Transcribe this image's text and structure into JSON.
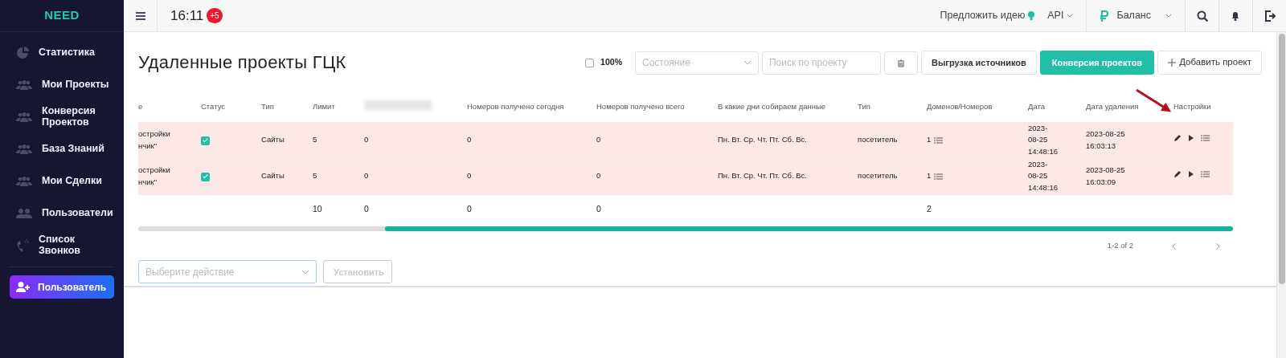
{
  "sidebar": {
    "logo": "NEED",
    "items": [
      {
        "label": "Статистика",
        "kind": "pie"
      },
      {
        "label": "Мои Проекты",
        "kind": "users"
      },
      {
        "label": "Конверсия Проектов",
        "kind": "users"
      },
      {
        "label": "База Знаний",
        "kind": "users"
      },
      {
        "label": "Мои Сделки",
        "kind": "users"
      },
      {
        "label": "Пользователи",
        "kind": "pair"
      },
      {
        "label": "Список Звонков",
        "kind": "phone"
      }
    ],
    "user_button": "Пользователь"
  },
  "topbar": {
    "time": "16:11",
    "badge": "+5",
    "idea_link": "Предложить идею",
    "api_link": "API",
    "balance": "Баланс"
  },
  "page": {
    "title": "Удаленные проекты ГЦК"
  },
  "toolbar": {
    "checkbox": {
      "label": "100%",
      "checked": false
    },
    "state_select": {
      "placeholder": "Состояние"
    },
    "search": {
      "placeholder": "Поиск по проекту"
    },
    "buttons": [
      {
        "label": "Выгрузка источников",
        "kind": "outline"
      },
      {
        "label": "Конверсия проектов",
        "kind": "primary"
      },
      {
        "label": "Добавить проект",
        "kind": "add"
      }
    ]
  },
  "table": {
    "columns": [
      {
        "label": "е"
      },
      {
        "label": "Статус"
      },
      {
        "label": "Тип"
      },
      {
        "label": "Лимит"
      },
      {
        "blurred": true
      },
      {
        "label": "Номеров получено сегодня"
      },
      {
        "label": "Номеров получено всего"
      },
      {
        "label": "В какие дни собираем данные"
      },
      {
        "label": "Тип"
      },
      {
        "label": "Доменов/Номеров"
      },
      {
        "label": "Дата"
      },
      {
        "label": "Дата удаления"
      },
      {
        "label": "Настройки"
      }
    ],
    "rows": [
      {
        "highlighted": true,
        "name": "остройки\nнчик\"",
        "status_checked": true,
        "type": "Сайты",
        "limit": "5",
        "column_5": "0",
        "today": "0",
        "total": "0",
        "days": "Пн. Вт. Ср. Чт. Пт. Сб. Вс.",
        "kind": "посетитель",
        "domains": "1",
        "date": "2023-\n08-25\n14:48:16",
        "deleted": "2023-08-25\n16:03:13"
      },
      {
        "highlighted": true,
        "name": "остройки\nнчик\"",
        "status_checked": true,
        "type": "Сайты",
        "limit": "5",
        "column_5": "0",
        "today": "0",
        "total": "0",
        "days": "Пн. Вт. Ср. Чт. Пт. Сб. Вс.",
        "kind": "посетитель",
        "domains": "1",
        "date": "2023-\n08-25\n14:48:16",
        "deleted": "2023-08-25\n16:03:09"
      }
    ],
    "totals": {
      "limit": "10",
      "column_5": "0",
      "today": "0",
      "total": "0",
      "domains": "2"
    },
    "pagination": "1-2 of 2"
  },
  "bulk_action": {
    "placeholder": "Выберите действие",
    "button": {
      "label": "Установить",
      "disabled": true
    }
  }
}
